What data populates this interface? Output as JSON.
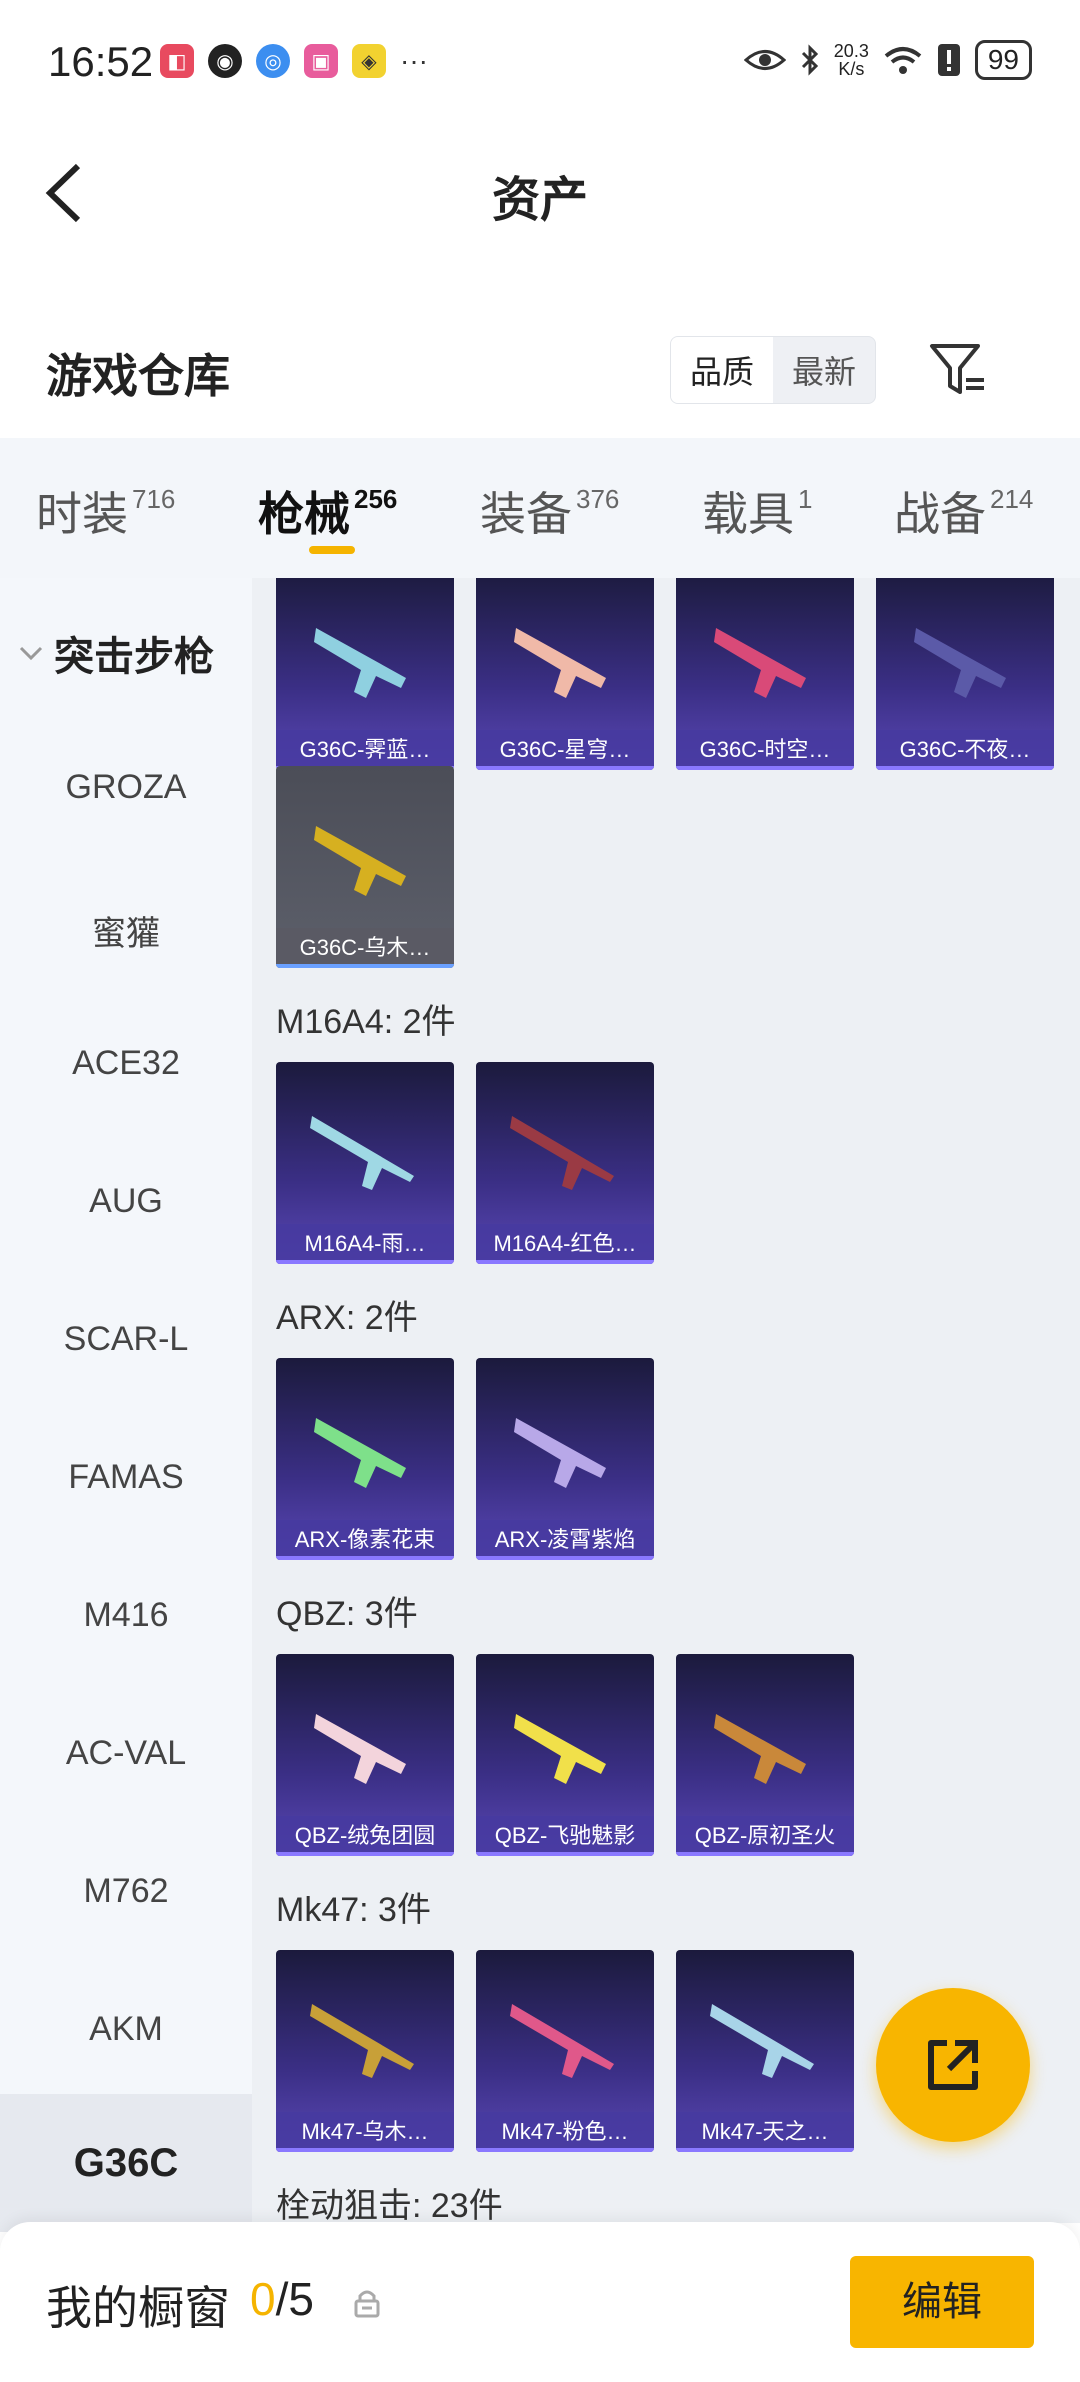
{
  "status_bar": {
    "time": "16:52",
    "speed_value": "20.3",
    "speed_unit": "K/s",
    "battery": "99"
  },
  "header": {
    "title": "资产"
  },
  "warehouse": {
    "title": "游戏仓库",
    "sort_options": [
      "品质",
      "最新"
    ],
    "active_sort": "品质"
  },
  "tabs": [
    {
      "label": "时装",
      "count": "716"
    },
    {
      "label": "枪械",
      "count": "256"
    },
    {
      "label": "装备",
      "count": "376"
    },
    {
      "label": "载具",
      "count": "1"
    },
    {
      "label": "战备",
      "count": "214"
    }
  ],
  "active_tab": "枪械",
  "sidebar": {
    "group": "突击步枪",
    "items": [
      "GROZA",
      "蜜獾",
      "ACE32",
      "AUG",
      "SCAR-L",
      "FAMAS",
      "M416",
      "AC-VAL",
      "M762",
      "AKM",
      "G36C"
    ],
    "active_item": "G36C"
  },
  "content": {
    "g36c_items": [
      "G36C-霁蓝…",
      "G36C-星穹…",
      "G36C-时空…",
      "G36C-不夜…",
      "G36C-乌木…"
    ],
    "m16_label": "M16A4: 2件",
    "m16_items": [
      "M16A4-雨…",
      "M16A4-红色…"
    ],
    "arx_label": "ARX: 2件",
    "arx_items": [
      "ARX-像素花束",
      "ARX-凌霄紫焰"
    ],
    "qbz_label": "QBZ: 3件",
    "qbz_items": [
      "QBZ-绒兔团圆",
      "QBZ-飞驰魅影",
      "QBZ-原初圣火"
    ],
    "mk47_label": "Mk47: 3件",
    "mk47_items": [
      "Mk47-乌木…",
      "Mk47-粉色…",
      "Mk47-天之…"
    ],
    "sniper_label": "栓动狙击: 23件"
  },
  "bottom": {
    "title": "我的橱窗",
    "current": "0",
    "total": "/5",
    "edit_label": "编辑"
  },
  "colors": {
    "accent": "#f8b500",
    "card_purple": "#3b2f86"
  }
}
